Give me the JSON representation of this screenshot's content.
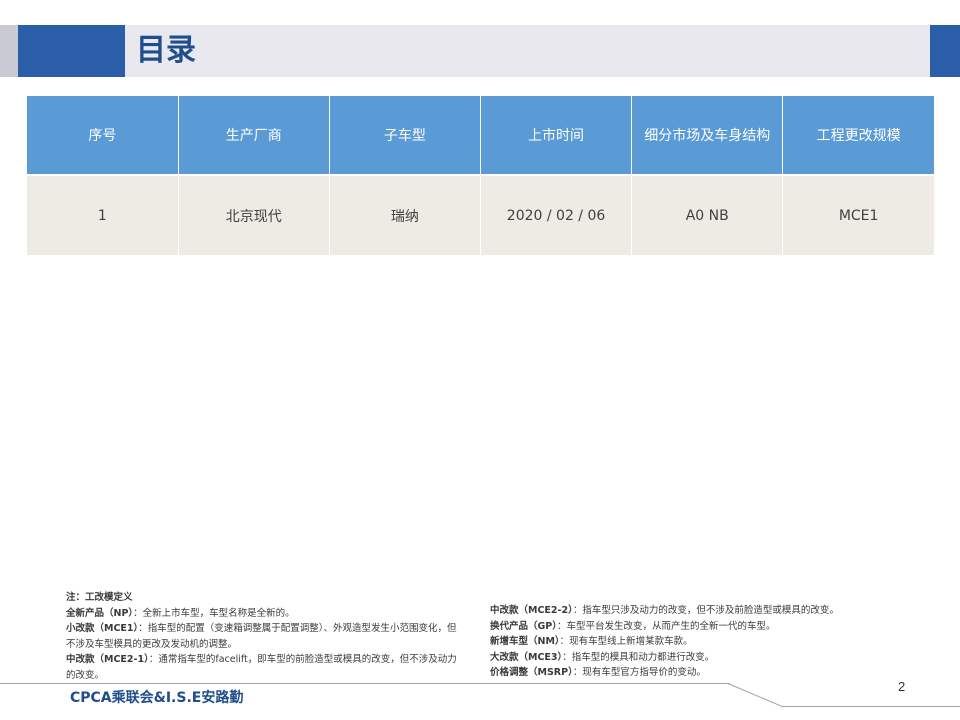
{
  "title": "目录",
  "table": {
    "headers": [
      "序号",
      "生产厂商",
      "子车型",
      "上市时间",
      "细分市场及车身结构",
      "工程更改规模"
    ],
    "rows": [
      [
        "1",
        "北京现代",
        "瑞纳",
        "2020 / 02 / 06",
        "A0 NB",
        "MCE1"
      ]
    ]
  },
  "notes": {
    "heading": "注：工改模定义",
    "left": [
      {
        "term": "全新产品（NP）",
        "desc": "：全新上市车型，车型名称是全新的。"
      },
      {
        "term": "小改款（MCE1）",
        "desc": "：指车型的配置（变速箱调整属于配置调整）、外观造型发生小范围变化，但不涉及车型模具的更改及发动机的调整。"
      },
      {
        "term": "中改款（MCE2-1）",
        "desc": "：通常指车型的facelift，即车型的前脸造型或模具的改变，但不涉及动力的改变。"
      }
    ],
    "right": [
      {
        "term": "中改款（MCE2-2）",
        "desc": "：指车型只涉及动力的改变，但不涉及前脸造型或模具的改变。"
      },
      {
        "term": "换代产品（GP）",
        "desc": "：车型平台发生改变，从而产生的全新一代的车型。"
      },
      {
        "term": "新增车型（NM）",
        "desc": "：现有车型线上新增某款车款。"
      },
      {
        "term": "大改款（MCE3）",
        "desc": "：指车型的模具和动力都进行改变。"
      },
      {
        "term": "价格调整（MSRP）",
        "desc": "：现有车型官方指导价的变动。"
      }
    ]
  },
  "footer": {
    "org": "CPCA乘联会&I.S.E安路勤",
    "page": "2"
  },
  "colors": {
    "accent_blue": "#2a5ea8",
    "header_blue": "#5b9bd5",
    "row_bg": "#edebe4",
    "title_text": "#1f4e8c"
  }
}
